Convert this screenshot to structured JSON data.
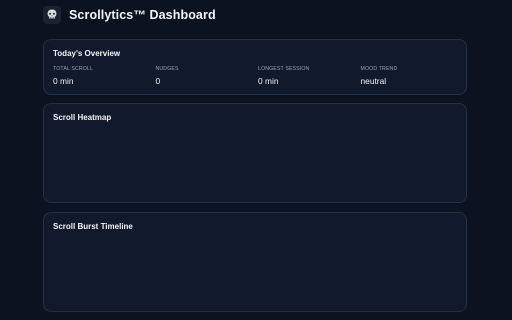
{
  "header": {
    "title": "Scrollytics™ Dashboard",
    "logo_icon": "skull-logo-icon"
  },
  "overview": {
    "title": "Today's Overview",
    "stats": [
      {
        "label": "TOTAL SCROLL",
        "value": "0 min"
      },
      {
        "label": "NUDGES",
        "value": "0"
      },
      {
        "label": "LONGEST SESSION",
        "value": "0 min"
      },
      {
        "label": "MOOD TREND",
        "value": "neutral"
      }
    ]
  },
  "heatmap": {
    "title": "Scroll Heatmap"
  },
  "timeline": {
    "title": "Scroll Burst Timeline"
  },
  "colors": {
    "background": "#0b1220",
    "card": "#111a2b",
    "border": "#243044",
    "text": "#f1f4f9",
    "muted": "#98a4b8"
  }
}
